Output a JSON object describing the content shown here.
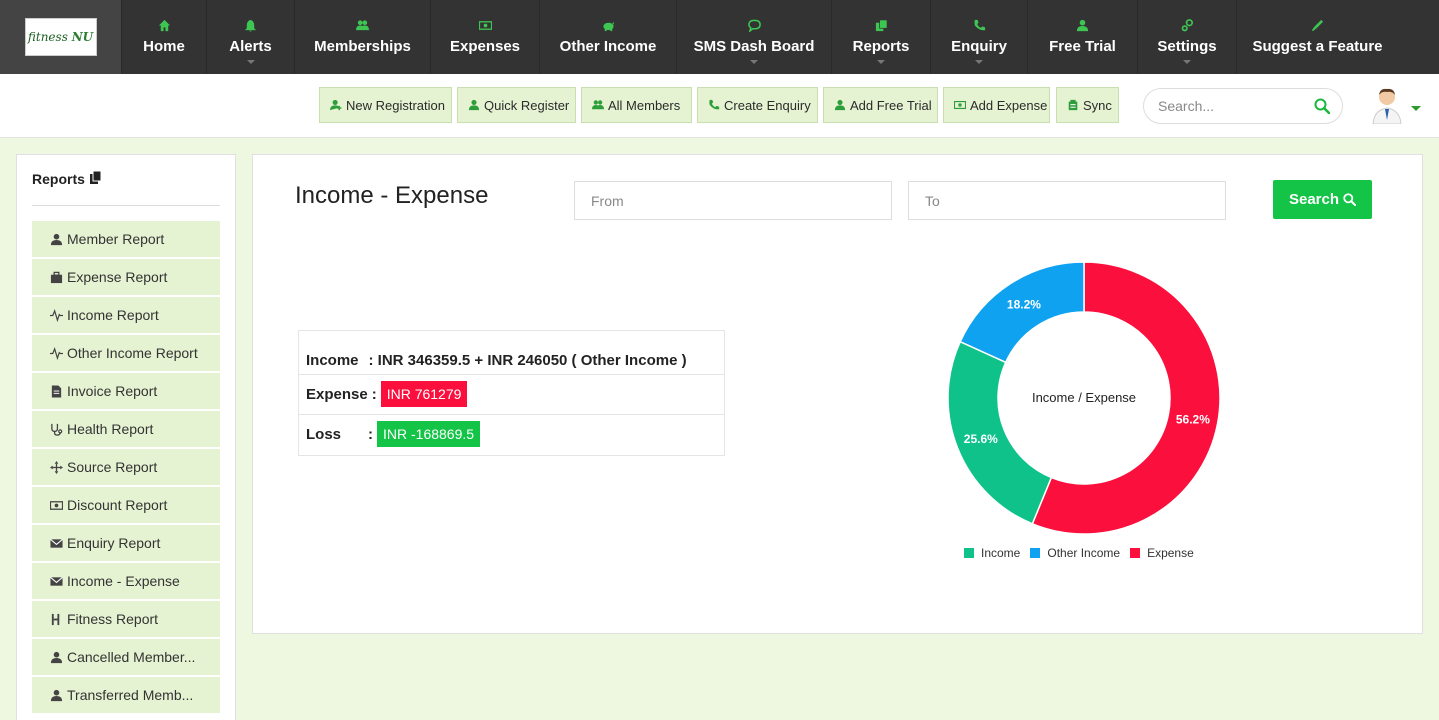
{
  "logo": {
    "brand": "fitness",
    "brand2": "NU"
  },
  "nav": [
    {
      "key": "home",
      "label": "Home",
      "icon": "home-icon",
      "caret": false
    },
    {
      "key": "alerts",
      "label": "Alerts",
      "icon": "bell-icon",
      "caret": true
    },
    {
      "key": "memberships",
      "label": "Memberships",
      "icon": "users-icon",
      "caret": false
    },
    {
      "key": "expenses",
      "label": "Expenses",
      "icon": "money-icon",
      "caret": false
    },
    {
      "key": "other-income",
      "label": "Other Income",
      "icon": "piggy-bank-icon",
      "caret": false
    },
    {
      "key": "sms",
      "label": "SMS Dash Board",
      "icon": "chat-icon",
      "caret": true
    },
    {
      "key": "reports",
      "label": "Reports",
      "icon": "copy-icon",
      "caret": true
    },
    {
      "key": "enquiry",
      "label": "Enquiry",
      "icon": "phone-icon",
      "caret": true
    },
    {
      "key": "free-trial",
      "label": "Free Trial",
      "icon": "user-icon",
      "caret": false
    },
    {
      "key": "settings",
      "label": "Settings",
      "icon": "gears-icon",
      "caret": true
    },
    {
      "key": "suggest",
      "label": "Suggest a Feature",
      "icon": "microphone-icon",
      "caret": false
    }
  ],
  "actions": [
    {
      "label": "New Registration",
      "icon": "user-plus-icon"
    },
    {
      "label": "Quick Register",
      "icon": "user-icon"
    },
    {
      "label": "All Members",
      "icon": "users-icon"
    },
    {
      "label": "Create Enquiry",
      "icon": "phone-icon"
    },
    {
      "label": "Add Free Trial",
      "icon": "user-add-icon"
    },
    {
      "label": "Add Expense",
      "icon": "money-icon"
    },
    {
      "label": "Sync",
      "icon": "sync-icon"
    }
  ],
  "search": {
    "placeholder": "Search..."
  },
  "sidebar": {
    "title": "Reports",
    "items": [
      {
        "label": "Member Report",
        "icon": "user-icon"
      },
      {
        "label": "Expense Report",
        "icon": "briefcase-icon"
      },
      {
        "label": "Income Report",
        "icon": "pulse-icon"
      },
      {
        "label": "Other Income Report",
        "icon": "pulse-icon"
      },
      {
        "label": "Invoice Report",
        "icon": "file-icon"
      },
      {
        "label": "Health Report",
        "icon": "stethoscope-icon"
      },
      {
        "label": "Source Report",
        "icon": "move-icon"
      },
      {
        "label": "Discount Report",
        "icon": "money-icon"
      },
      {
        "label": "Enquiry Report",
        "icon": "envelope-icon"
      },
      {
        "label": "Income - Expense",
        "icon": "envelope-icon"
      },
      {
        "label": "Fitness Report",
        "icon": "fitness-icon"
      },
      {
        "label": "Cancelled Member...",
        "icon": "user-icon"
      },
      {
        "label": "Transferred Memb...",
        "icon": "user-icon"
      }
    ]
  },
  "main": {
    "title": "Income - Expense",
    "from_placeholder": "From",
    "to_placeholder": "To",
    "search_label": "Search",
    "summary": {
      "income_label": "Income",
      "income_value": ": INR 346359.5 + INR 246050 ( Other Income )",
      "expense_label": "Expense",
      "expense_sep": ":",
      "expense_value": "INR 761279",
      "loss_label": "Loss",
      "loss_sep": ":",
      "loss_value": "INR -168869.5"
    }
  },
  "colors": {
    "income": "#0ec28a",
    "other_income": "#0fa2f0",
    "expense": "#fb0f3d",
    "nav_bg": "#333333",
    "accent": "#13c447"
  },
  "chart_data": {
    "type": "pie",
    "center_label": "Income / Expense",
    "categories": [
      "Income",
      "Other Income",
      "Expense"
    ],
    "values": [
      25.6,
      18.2,
      56.2
    ],
    "data_labels": [
      "25.6%",
      "18.2%",
      "56.2%"
    ],
    "colors": [
      "#0ec28a",
      "#0fa2f0",
      "#fb0f3d"
    ],
    "legend": "bottom"
  }
}
